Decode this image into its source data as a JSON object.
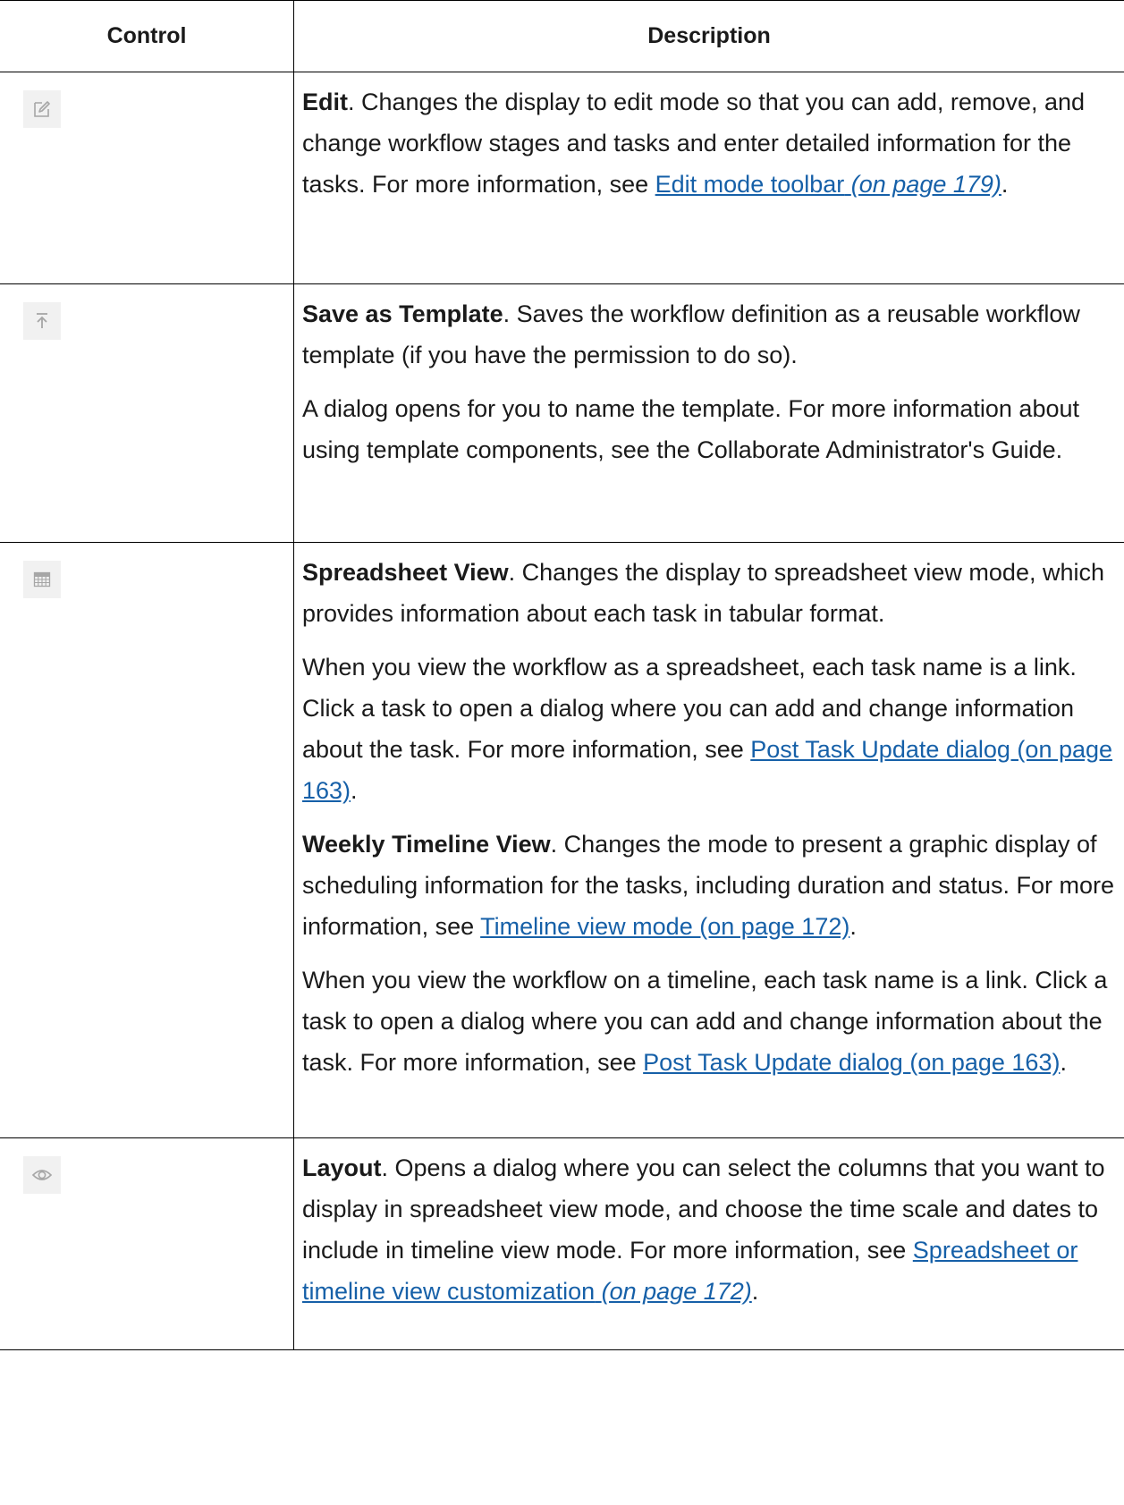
{
  "table": {
    "header_control": "Control",
    "header_description": "Description"
  },
  "icons": {
    "edit": "edit-icon",
    "save_template": "save-as-template-icon",
    "spreadsheet": "spreadsheet-view-icon",
    "layout": "layout-eye-icon"
  },
  "rows": {
    "edit": {
      "term": "Edit",
      "text1": ". Changes the display to edit mode so that you can add, remove, and change workflow stages and tasks and enter detailed information for the tasks. For more information, see ",
      "link": "Edit mode toolbar",
      "link_page": "(on page 179)",
      "text2": "."
    },
    "save": {
      "term": "Save as Template",
      "text1": ". Saves the workflow definition as a reusable workflow template (if you have the permission to do so).",
      "p2": "A dialog opens for you to name the template. For more information about using template components, see the  Collaborate Administrator's Guide."
    },
    "spreadsheet": {
      "term": "Spreadsheet View",
      "text1": ". Changes the display to spreadsheet view mode, which provides information about each task in tabular format.",
      "p2_text": "When you view the workflow as a spreadsheet, each task name is a link. Click a task to open a dialog where you can add and change information about the task. For more information, see ",
      "p2_link": "Post Task Update dialog (on page 163)",
      "p2_end": ".",
      "term3": "Weekly Timeline View",
      "p3_text": ". Changes the mode to present a graphic display of scheduling information for the tasks, including duration and status. For more information, see ",
      "p3_link": "Timeline view mode (on page 172)",
      "p3_end": ".",
      "p4_text": "When you view the workflow on a timeline, each task name is a link. Click a task to open a dialog where you can add and change information about the task. For more information, see ",
      "p4_link": "Post Task Update dialog (on page 163)",
      "p4_end": "."
    },
    "layout": {
      "term": "Layout",
      "text1": ". Opens a dialog where you can select the columns that you want to display in spreadsheet view mode, and choose the time scale and dates to include in timeline view mode. For more information, see ",
      "link": "Spreadsheet or timeline view customization",
      "link_page": "(on page 172)",
      "text2": "."
    }
  },
  "colors": {
    "link": "#1660a8",
    "border": "#000000",
    "icon_bg": "#f1f1f1",
    "icon_stroke": "#a6a6a6"
  }
}
